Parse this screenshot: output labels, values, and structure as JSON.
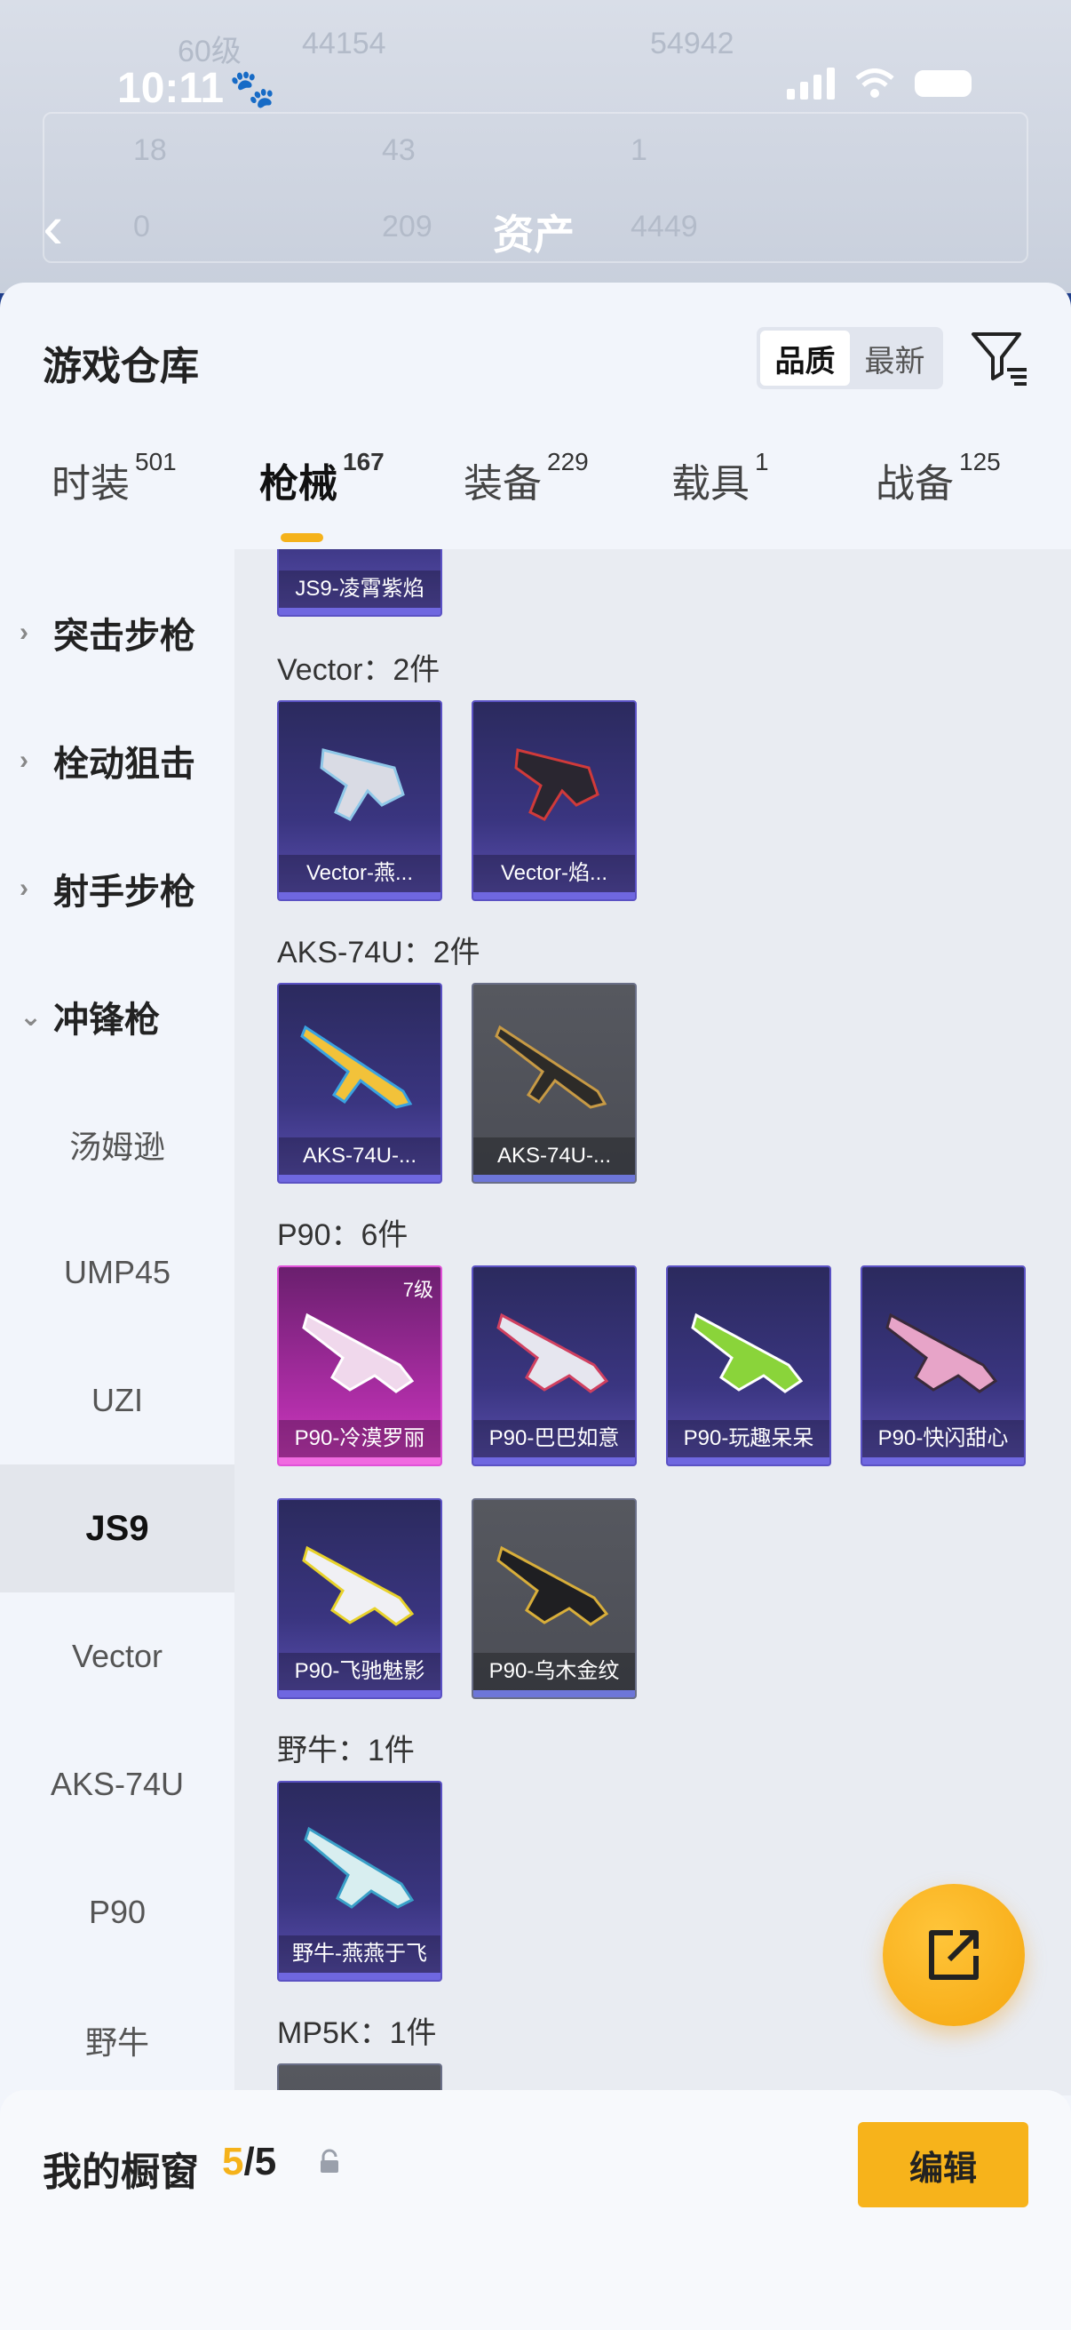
{
  "status": {
    "time": "10:11"
  },
  "header": {
    "title": "资产",
    "bg_texts": [
      "60级",
      "44154",
      "54942",
      "18",
      "43",
      "1",
      "0",
      "209",
      "4449"
    ]
  },
  "panel": {
    "title": "游戏仓库",
    "sort": {
      "options": [
        "品质",
        "最新"
      ],
      "active": "品质"
    }
  },
  "tabs": [
    {
      "label": "时装",
      "count": "501"
    },
    {
      "label": "枪械",
      "count": "167"
    },
    {
      "label": "装备",
      "count": "229"
    },
    {
      "label": "载具",
      "count": "1"
    },
    {
      "label": "战备",
      "count": "125"
    }
  ],
  "sidebar": {
    "categories": [
      "突击步枪",
      "栓动狙击",
      "射手步枪",
      "冲锋枪"
    ],
    "items": [
      "汤姆逊",
      "UMP45",
      "UZI",
      "JS9",
      "Vector",
      "AKS-74U",
      "P90",
      "野牛"
    ],
    "active": "JS9"
  },
  "content": {
    "top_card": "JS9-凌霄紫焰",
    "groups": [
      {
        "label": "Vector：2件",
        "cards": [
          {
            "name": "Vector-燕...",
            "style": "purple"
          },
          {
            "name": "Vector-焰...",
            "style": "purple"
          }
        ]
      },
      {
        "label": "AKS-74U：2件",
        "cards": [
          {
            "name": "AKS-74U-...",
            "style": "purple"
          },
          {
            "name": "AKS-74U-...",
            "style": "gray"
          }
        ]
      },
      {
        "label": "P90：6件",
        "cards": [
          {
            "name": "P90-冷漠罗丽",
            "style": "pink",
            "level": "7级"
          },
          {
            "name": "P90-巴巴如意",
            "style": "purple"
          },
          {
            "name": "P90-玩趣呆呆",
            "style": "purple"
          },
          {
            "name": "P90-快闪甜心",
            "style": "purple"
          },
          {
            "name": "P90-飞驰魅影",
            "style": "purple"
          },
          {
            "name": "P90-乌木金纹",
            "style": "gray"
          }
        ]
      },
      {
        "label": "野牛：1件",
        "cards": [
          {
            "name": "野牛-燕燕于飞",
            "style": "purple"
          }
        ]
      },
      {
        "label": "MP5K：1件",
        "cards": []
      }
    ]
  },
  "bottom": {
    "label": "我的橱窗",
    "current": "5",
    "total": "/5",
    "edit": "编辑"
  },
  "colors": {
    "accent": "#f5b21a",
    "panel_bg": "#f2f5fb",
    "content_bg": "#e9ecf2"
  }
}
